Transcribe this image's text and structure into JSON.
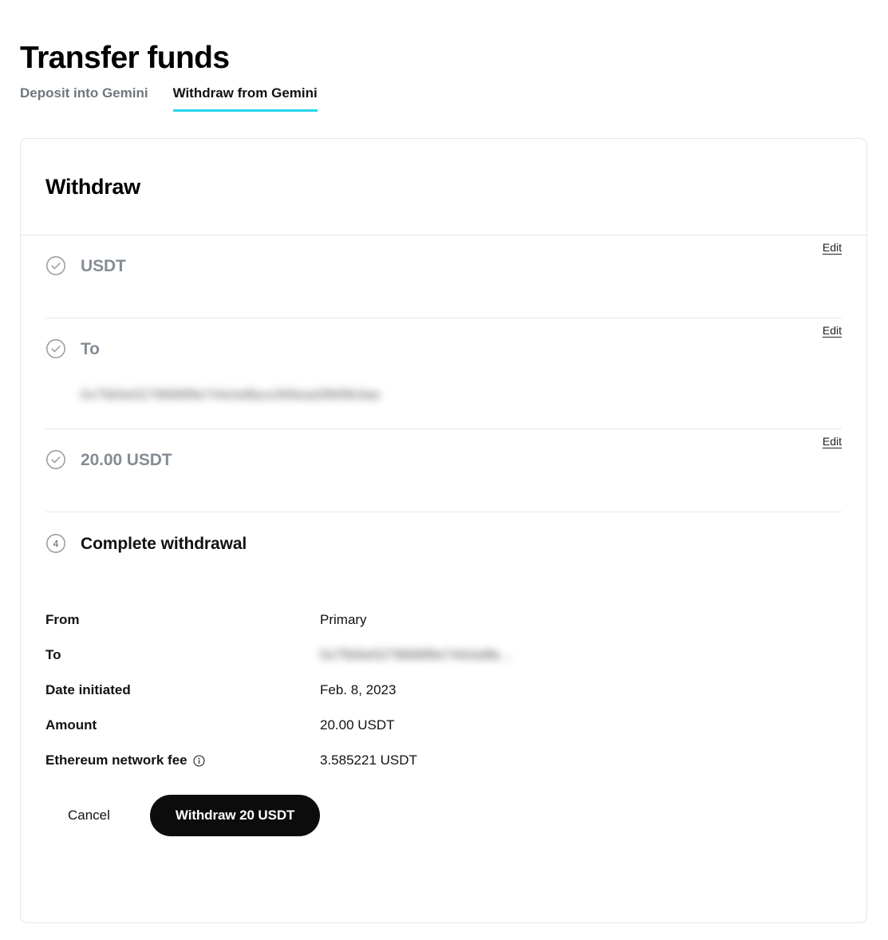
{
  "header": {
    "title": "Transfer funds",
    "tabs": [
      {
        "label": "Deposit into Gemini",
        "active": false
      },
      {
        "label": "Withdraw from Gemini",
        "active": true
      }
    ]
  },
  "colors": {
    "accent": "#26d4f0",
    "primary_button_bg": "#0c0c0c",
    "muted_text": "#868c94",
    "border": "#e6e6e6"
  },
  "card": {
    "title": "Withdraw",
    "steps": [
      {
        "icon": "check-circle-icon",
        "label": "USDT",
        "edit_label": "Edit"
      },
      {
        "icon": "check-circle-icon",
        "label": "To",
        "edit_label": "Edit",
        "address": "0x75b5e5279688f9e744cbdface366ead3fbf9b3ae"
      },
      {
        "icon": "check-circle-icon",
        "label": "20.00 USDT",
        "edit_label": "Edit"
      },
      {
        "icon": "step-number-icon",
        "step_number": "4",
        "label": "Complete withdrawal"
      }
    ],
    "details": [
      {
        "label": "From",
        "value": "Primary",
        "blurred": false,
        "info": false
      },
      {
        "label": "To",
        "value": "0x75b5e5279688f9e744cbdfa…",
        "blurred": true,
        "info": false
      },
      {
        "label": "Date initiated",
        "value": "Feb. 8, 2023",
        "blurred": false,
        "info": false
      },
      {
        "label": "Amount",
        "value": "20.00 USDT",
        "blurred": false,
        "info": false
      },
      {
        "label": "Ethereum network fee",
        "value": "3.585221 USDT",
        "blurred": false,
        "info": true
      }
    ],
    "actions": {
      "cancel_label": "Cancel",
      "submit_label": "Withdraw 20 USDT"
    }
  }
}
